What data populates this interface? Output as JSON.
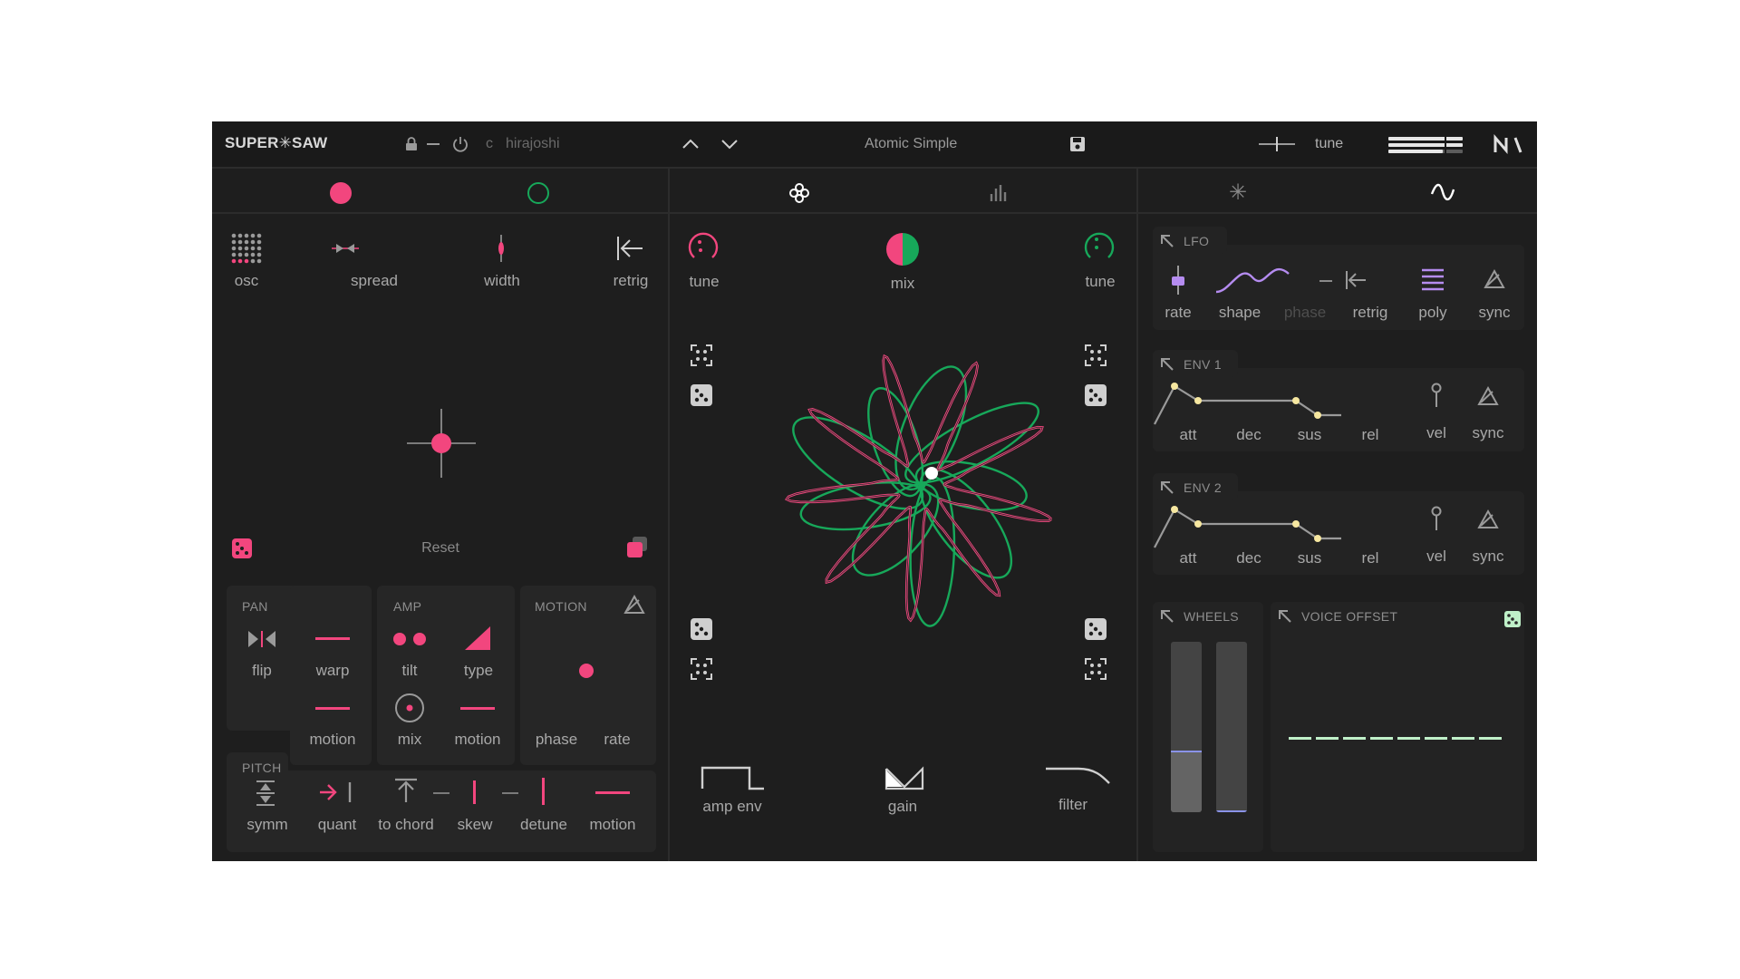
{
  "header": {
    "logo_left": "SUPER",
    "logo_right": "SAW",
    "scale_key": "c",
    "scale_name": "hirajoshi",
    "preset_name": "Atomic Simple",
    "tune_label": "tune",
    "icons": [
      "lock-icon",
      "minus-icon",
      "power-icon",
      "chevron-up-icon",
      "chevron-down-icon",
      "save-icon",
      "ni-logo"
    ]
  },
  "tabs": {
    "left": [
      "oscillator-1",
      "oscillator-2"
    ],
    "middle": [
      "motion-flower",
      "spectrum"
    ],
    "right": [
      "fx",
      "modulation"
    ]
  },
  "osc_panel": {
    "controls": [
      "osc",
      "spread",
      "width",
      "retrig"
    ],
    "reset_label": "Reset"
  },
  "pan": {
    "title": "PAN",
    "flip": "flip",
    "warp": "warp",
    "motion": "motion"
  },
  "amp": {
    "title": "AMP",
    "tilt": "tilt",
    "type": "type",
    "mix": "mix",
    "motion": "motion"
  },
  "motion_panel": {
    "title": "MOTION",
    "phase": "phase",
    "rate": "rate"
  },
  "pitch": {
    "title": "PITCH",
    "controls": [
      "symm",
      "quant",
      "to chord",
      "skew",
      "detune",
      "motion"
    ]
  },
  "center": {
    "tune_left": "tune",
    "mix": "mix",
    "tune_right": "tune",
    "amp_env": "amp env",
    "gain": "gain",
    "filter": "filter"
  },
  "lfo": {
    "title": "LFO",
    "controls": [
      "rate",
      "shape",
      "phase",
      "retrig",
      "poly",
      "sync"
    ]
  },
  "env1": {
    "title": "ENV 1",
    "controls": [
      "att",
      "dec",
      "sus",
      "rel",
      "vel",
      "sync"
    ]
  },
  "env2": {
    "title": "ENV 2",
    "controls": [
      "att",
      "dec",
      "sus",
      "rel",
      "vel",
      "sync"
    ]
  },
  "wheels": {
    "title": "WHEELS",
    "wheel_1_level": 0.35,
    "wheel_2_level": 0.0
  },
  "voice_offset": {
    "title": "VOICE OFFSET"
  },
  "colors": {
    "pink": "#f2467e",
    "green": "#17a85a",
    "purple": "#b58cf0",
    "mint": "#bff0c8",
    "yellow": "#f6e7a0",
    "bg": "#1e1e1e"
  }
}
